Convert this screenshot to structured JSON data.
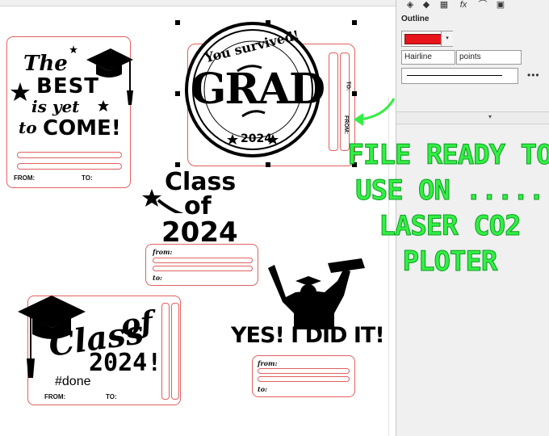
{
  "panel": {
    "title": "Outline",
    "tabs": [
      "properties-tab",
      "fill-tab",
      "pattern-tab",
      "effects-tab",
      "pen-tab",
      "image-tab"
    ],
    "tab_glyphs": [
      "◈",
      "◆",
      "▦",
      "fx",
      "⌒",
      "▣"
    ],
    "outline_color": "#e8141c",
    "width_value": "Hairline",
    "unit_value": "points",
    "more_label": "•••",
    "expand_glyph": "▾"
  },
  "overlay": {
    "lines": [
      "FILE READY TO",
      "USE ON .....",
      "LASER CO2",
      "PLOTER"
    ],
    "color": "#33ee44"
  },
  "tags": {
    "best": {
      "line1": "The",
      "line2": "BEST",
      "line3": "is yet",
      "line4a": "to",
      "line4b": "COME!",
      "from": "FROM:",
      "to": "TO:"
    },
    "grad": {
      "top": "You survived!",
      "main": "GRAD",
      "year": "2024",
      "to": "TO:",
      "from": "FROM:"
    },
    "class_mid": {
      "line1": "Class",
      "line2": "of",
      "line3": "2024",
      "from": "from:",
      "to": "to:"
    },
    "class_left": {
      "line1": "Class",
      "line2": "of",
      "line3": "2024!",
      "hashtag": "#done",
      "from": "FROM:",
      "to": "TO:"
    },
    "yes": {
      "main": "YES! I DID IT!",
      "from": "from:",
      "to": "to:"
    }
  }
}
